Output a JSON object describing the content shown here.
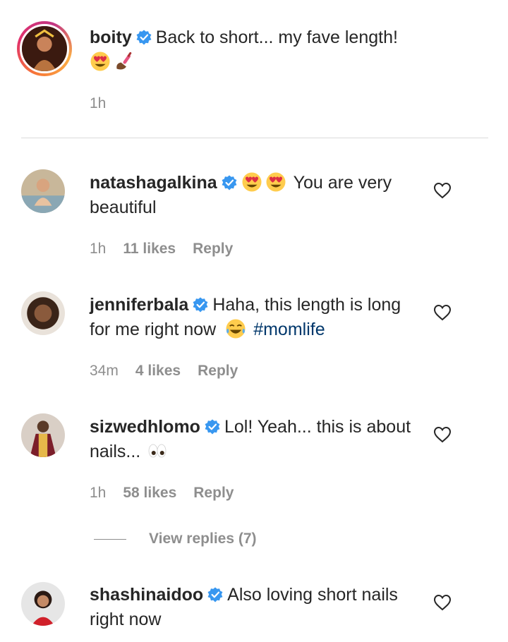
{
  "caption": {
    "username": "boity",
    "text": "Back to short... my fave length!",
    "time": "1h"
  },
  "comments": [
    {
      "username": "natashagalkina",
      "text_before": "",
      "text_after": "You are very beautiful",
      "time": "1h",
      "likes": "11 likes",
      "reply": "Reply"
    },
    {
      "username": "jenniferbala",
      "text": "Haha, this length is long for me right now",
      "hashtag": "#momlife",
      "time": "34m",
      "likes": "4 likes",
      "reply": "Reply"
    },
    {
      "username": "sizwedhlomo",
      "text": "Lol! Yeah... this is about nails...",
      "time": "1h",
      "likes": "58 likes",
      "reply": "Reply"
    },
    {
      "username": "shashinaidoo",
      "text": "Also loving short nails right now"
    }
  ],
  "view_replies": "View replies (7)",
  "colors": {
    "verified": "#3897f0",
    "hashtag": "#00376b",
    "muted": "#8e8e8e",
    "text": "#262626"
  }
}
